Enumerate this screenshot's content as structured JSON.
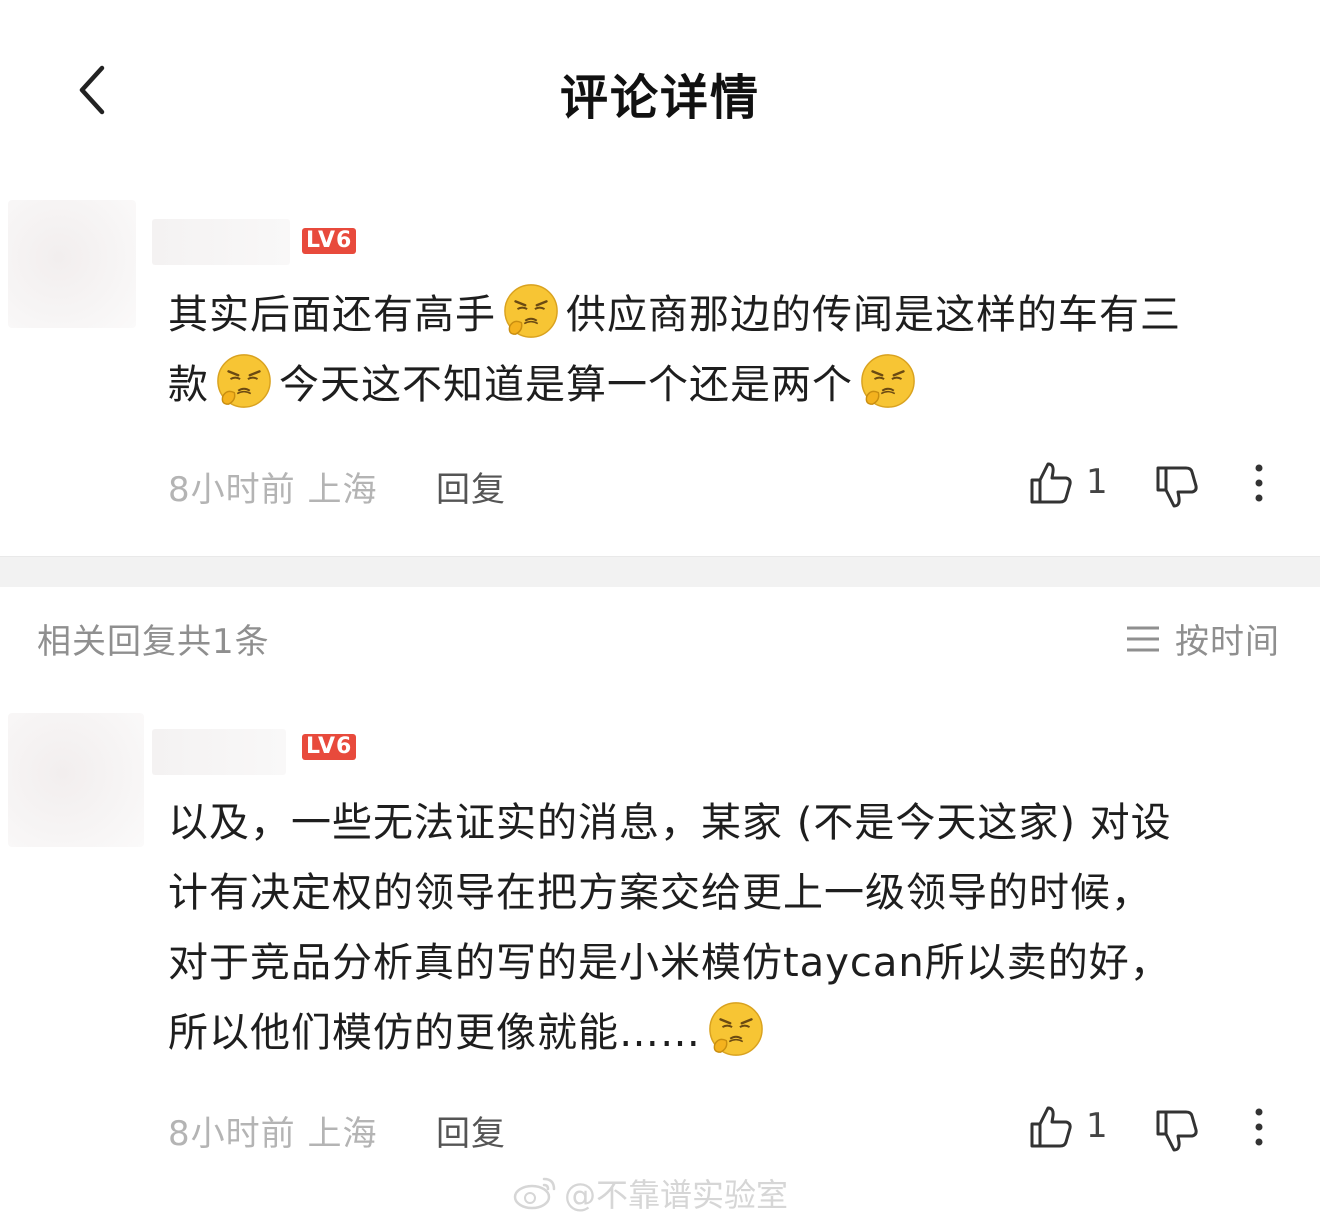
{
  "header": {
    "title": "评论详情"
  },
  "comment": {
    "level": "LV6",
    "text_part1": "其实后面还有高手",
    "text_part2": "供应商那边的传闻是这样的车有三",
    "text_part3": "款",
    "text_part4": "今天这不知道是算一个还是两个",
    "time": "8小时前",
    "location": "上海",
    "reply_label": "回复",
    "like_count": "1"
  },
  "replies_section": {
    "count_label": "相关回复共1条",
    "sort_label": "按时间"
  },
  "reply": {
    "level": "LV6",
    "line1": "以及，一些无法证实的消息，某家 (不是今天这家) 对设",
    "line2": "计有决定权的领导在把方案交给更上一级领导的时候，",
    "line3": "对于竞品分析真的写的是小米模仿taycan所以卖的好，",
    "line4": "所以他们模仿的更像就能……",
    "time": "8小时前",
    "location": "上海",
    "reply_label": "回复",
    "like_count": "1"
  },
  "watermark": "@不靠谱实验室",
  "colors": {
    "badge": "#e84a3c",
    "meta_text": "#b4b4b4",
    "separator": "#f2f2f2"
  },
  "icons": {
    "back": "chevron-left-icon",
    "emoji": "smug-face-emoji",
    "like": "thumbs-up-icon",
    "dislike": "thumbs-down-icon",
    "more": "more-vertical-icon",
    "sort": "sort-lines-icon",
    "watermark": "weibo-logo-icon"
  }
}
